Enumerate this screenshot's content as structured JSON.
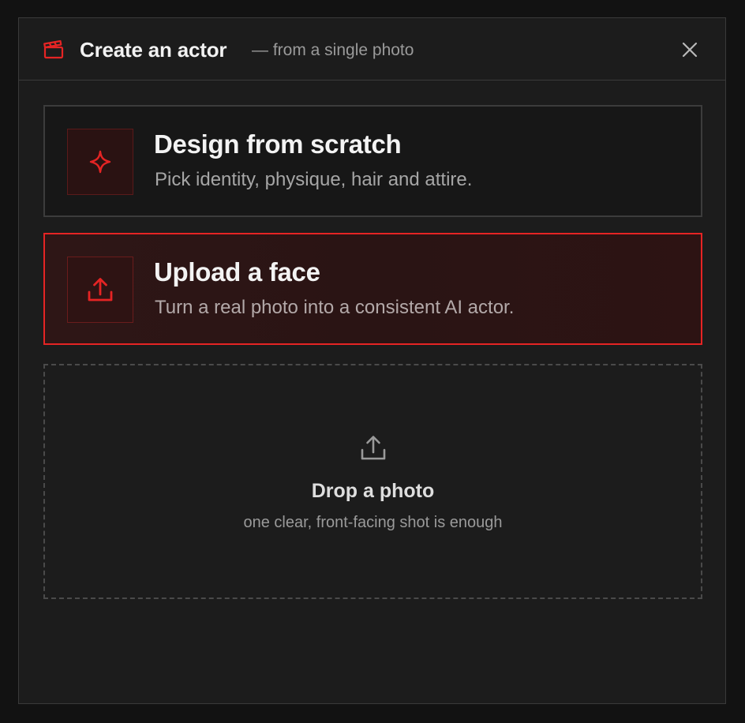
{
  "header": {
    "title": "Create an actor",
    "subtitle": "— from a single photo",
    "icon": "clapperboard-icon",
    "close_icon": "close-icon"
  },
  "options": [
    {
      "title": "Design from scratch",
      "description": "Pick identity, physique, hair and attire.",
      "icon": "sparkle-icon",
      "selected": false
    },
    {
      "title": "Upload a face",
      "description": "Turn a real photo into a consistent AI actor.",
      "icon": "upload-icon",
      "selected": true
    }
  ],
  "dropzone": {
    "title": "Drop a photo",
    "subtitle": "one clear, front-facing shot is enough",
    "icon": "upload-icon"
  },
  "colors": {
    "accent": "#e52424",
    "background": "#1c1c1c",
    "page": "#121212"
  }
}
